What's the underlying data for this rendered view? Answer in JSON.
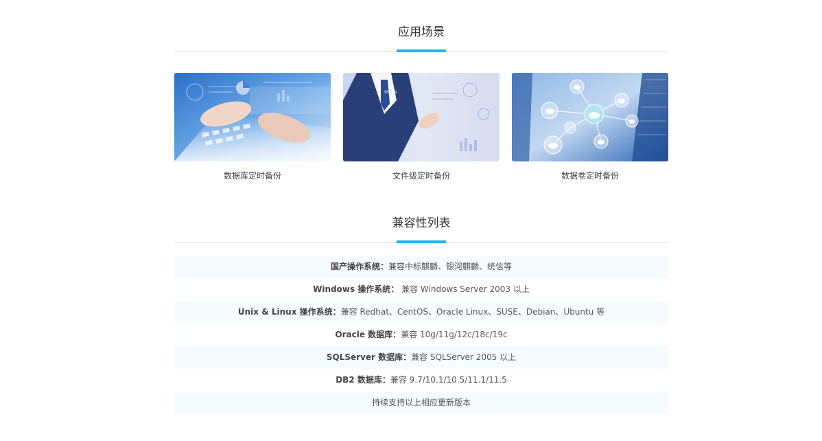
{
  "section1": {
    "title": "应用场景",
    "cards": [
      {
        "caption": "数据库定时备份",
        "image_icon": "keyboard-typing-image"
      },
      {
        "caption": "文件级定时备份",
        "image_icon": "business-dashboard-image"
      },
      {
        "caption": "数据卷定时备份",
        "image_icon": "cloud-network-image"
      }
    ]
  },
  "section2": {
    "title": "兼容性列表",
    "rows": [
      {
        "label": "国产操作系统：",
        "value": "兼容中标麒麟、银河麒麟、统信等"
      },
      {
        "label": "Windows 操作系统：",
        "value": " 兼容 Windows Server 2003 以上"
      },
      {
        "label": "Unix & Linux 操作系统：",
        "value": "兼容 Redhat、CentOS、Oracle Linux、SUSE、Debian、Ubuntu 等"
      },
      {
        "label": "Oracle 数据库：",
        "value": "兼容 10g/11g/12c/18c/19c"
      },
      {
        "label": "SQLServer 数据库：",
        "value": "兼容 SQLServer 2005 以上"
      },
      {
        "label": "DB2 数据库：",
        "value": "兼容 9.7/10.1/10.5/11.1/11.5"
      },
      {
        "label": "",
        "value": "持续支持以上相应更新版本"
      }
    ]
  },
  "colors": {
    "accent": "#1fb7ea",
    "divider": "#dcdcdc",
    "row_alt_bg": "#f6fbfe"
  }
}
